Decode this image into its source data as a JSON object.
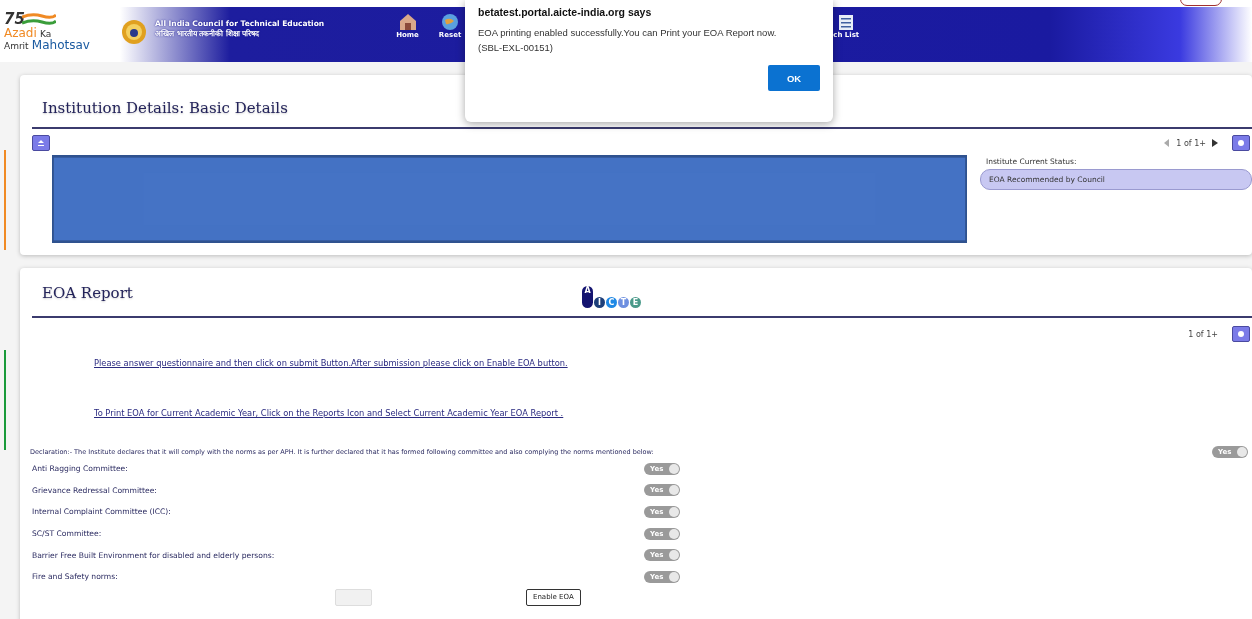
{
  "header": {
    "logo_lines": [
      "Azadi",
      "Ka",
      "Amrit",
      "Mahotsav"
    ],
    "logo_number": "75",
    "org_name": "All India Council for Technical Education",
    "org_name_hindi": "अखिल भारतीय तकनीकी शिक्षा परिषद",
    "nav": [
      {
        "label": "Home"
      },
      {
        "label": "Reset"
      },
      {
        "label": "ch List"
      }
    ]
  },
  "dialog": {
    "title": "betatest.portal.aicte-india.org says",
    "message": "EOA printing enabled successfully.You can Print your EOA Report now.",
    "code": "(SBL-EXL-00151)",
    "button": "OK"
  },
  "basic_details": {
    "title": "Institution Details: Basic Details",
    "pager": "1 of 1+",
    "status_label": "Institute Current Status:",
    "status_value": "EOA Recommended by Council"
  },
  "eoa_report": {
    "title": "EOA Report",
    "logo_letters": [
      "A",
      "I",
      "C",
      "T",
      "E"
    ],
    "pager": "1 of 1+",
    "links": [
      "Please answer questionnaire and then click on submit Button.After submission please click on Enable EOA button.",
      "To Print EOA for Current Academic Year, Click on the Reports Icon and Select Current Academic Year EOA Report ."
    ],
    "declaration": {
      "text": "Declaration:- The Institute declares that it will comply with the norms as per APH. It is further declared that it has formed following committee and also complying the norms mentioned below:",
      "toggle": {
        "label": "Yes",
        "disabled": true
      }
    },
    "items": [
      {
        "label": "Anti Ragging Committee:",
        "toggle": {
          "label": "Yes",
          "disabled": true
        }
      },
      {
        "label": "Grievance Redressal Committee:",
        "toggle": {
          "label": "Yes",
          "disabled": true
        }
      },
      {
        "label": "Internal Complaint Committee (ICC):",
        "toggle": {
          "label": "Yes",
          "disabled": true
        }
      },
      {
        "label": "SC/ST Committee:",
        "toggle": {
          "label": "Yes",
          "disabled": true
        }
      },
      {
        "label": "Barrier Free Built Environment for disabled and elderly persons:",
        "toggle": {
          "label": "Yes",
          "disabled": true
        }
      },
      {
        "label": "Fire and Safety norms:",
        "toggle": {
          "label": "Yes",
          "disabled": true
        }
      }
    ],
    "buttons": [
      {
        "disabled": true
      },
      {
        "label": "Enable EOA",
        "disabled": false
      }
    ]
  }
}
